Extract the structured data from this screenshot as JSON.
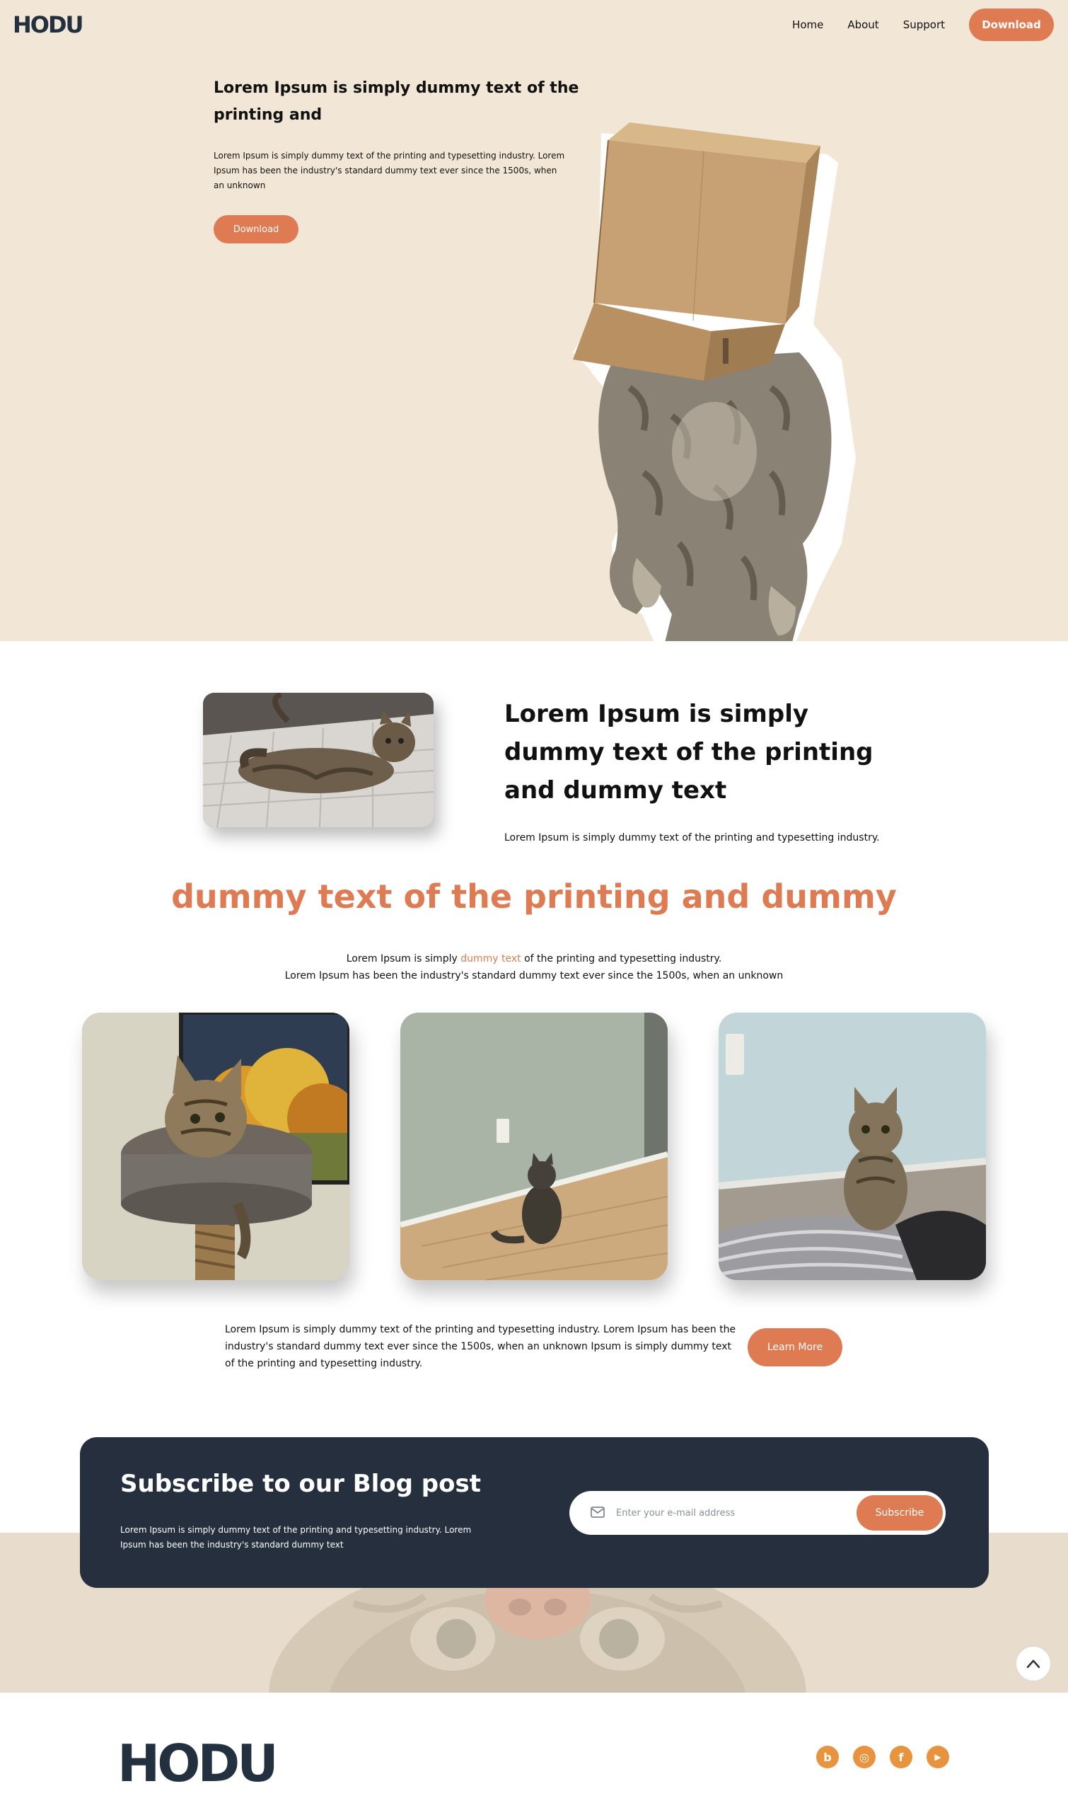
{
  "brand": {
    "logo_text": "HODU",
    "accent_color": "#de7b52",
    "dark_color": "#252f3e",
    "hero_bg": "#f2e7d6"
  },
  "nav": {
    "items": [
      {
        "label": "Home"
      },
      {
        "label": "About"
      },
      {
        "label": "Support"
      }
    ],
    "download_label": "Download"
  },
  "hero": {
    "title": "Lorem Ipsum is simply dummy text of the printing and",
    "text": "Lorem Ipsum is simply dummy text of the printing and typesetting industry. Lorem Ipsum has been the industry's standard dummy text ever since the 1500s, when an unknown",
    "button_label": "Download"
  },
  "about": {
    "title": "Lorem Ipsum is simply dummy text of the printing and dummy text",
    "text": "Lorem Ipsum is simply dummy text of the printing and typesetting industry."
  },
  "section": {
    "title": "dummy text of the printing and dummy",
    "line1_before": "Lorem Ipsum is simply ",
    "line1_highlight": "dummy text",
    "line1_after": " of the printing and typesetting industry.",
    "line2": "Lorem Ipsum has been the industry's standard dummy text ever since the 1500s, when an unknown"
  },
  "cta": {
    "text": "Lorem Ipsum is simply dummy text of the printing and typesetting industry. Lorem Ipsum has been the industry's standard dummy text ever since the 1500s, when an unknown Ipsum is simply dummy text of the printing and typesetting industry.",
    "button_label": "Learn More"
  },
  "subscribe": {
    "title": "Subscribe to our Blog post",
    "text": "Lorem Ipsum is simply dummy text of the printing and typesetting industry. Lorem Ipsum has been the industry's standard dummy text",
    "input_placeholder": "Enter your e-mail address",
    "button_label": "Subscribe"
  },
  "footer": {
    "logo_text": "HODU",
    "socials": [
      {
        "icon": "blog-icon",
        "glyph": "b"
      },
      {
        "icon": "instagram-icon",
        "glyph": "◎"
      },
      {
        "icon": "facebook-icon",
        "glyph": "f"
      },
      {
        "icon": "youtube-icon",
        "glyph": "▶"
      }
    ]
  }
}
